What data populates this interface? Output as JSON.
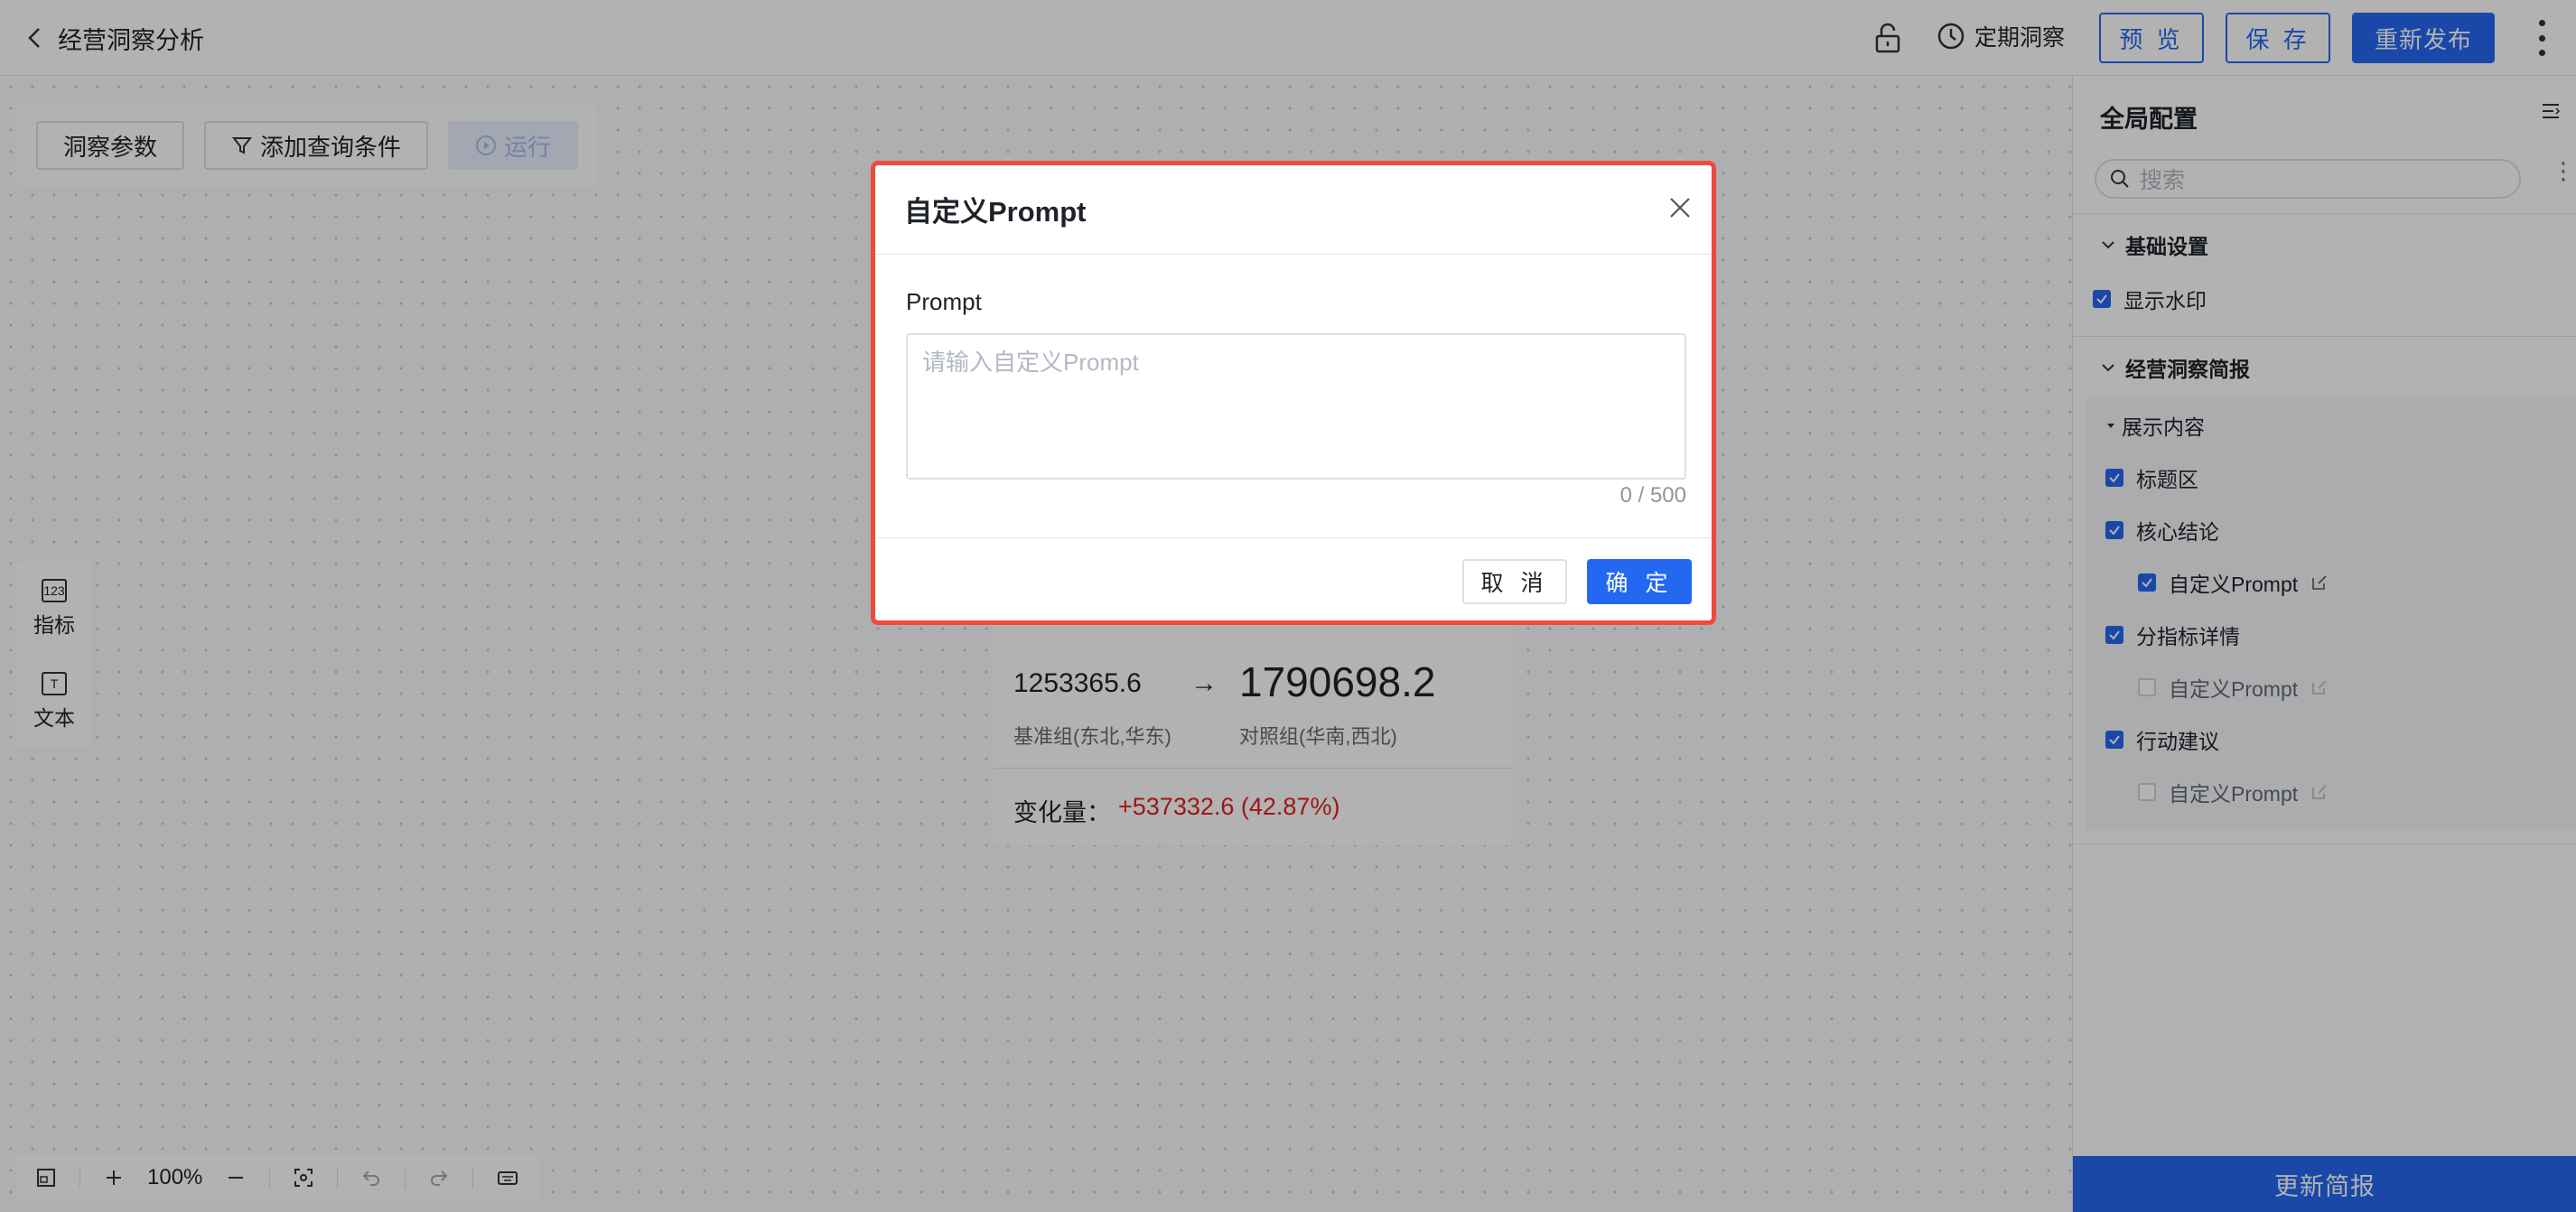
{
  "header": {
    "title": "经营洞察分析",
    "schedule_label": "定期洞察",
    "preview_label": "预 览",
    "save_label": "保 存",
    "republish_label": "重新发布"
  },
  "toolbar": {
    "params_label": "洞察参数",
    "add_filter_label": "添加查询条件",
    "run_label": "运行"
  },
  "side_tools": [
    {
      "label": "指标",
      "icon": "metric-icon"
    },
    {
      "label": "文本",
      "icon": "text-icon"
    }
  ],
  "metric_card": {
    "base_value": "1253365.6",
    "arrow": "→",
    "compare_value": "1790698.2",
    "base_label": "基准组(东北,华东)",
    "compare_label": "对照组(华南,西北)",
    "change_prefix": "变化量：",
    "change_value": "+537332.6 (42.87%)"
  },
  "bottom_bar": {
    "zoom": "100%"
  },
  "panel": {
    "title": "全局配置",
    "search_placeholder": "搜索",
    "section_basic": "基础设置",
    "show_watermark": "显示水印",
    "section_brief": "经营洞察简报",
    "display_content": "展示内容",
    "items": [
      {
        "label": "标题区",
        "checked": true
      },
      {
        "label": "核心结论",
        "checked": true
      },
      {
        "label": "自定义Prompt",
        "checked": true
      },
      {
        "label": "分指标详情",
        "checked": true
      },
      {
        "label": "自定义Prompt",
        "checked": false
      },
      {
        "label": "行动建议",
        "checked": true
      },
      {
        "label": "自定义Prompt",
        "checked": false
      }
    ],
    "update_label": "更新简报"
  },
  "modal": {
    "title": "自定义Prompt",
    "field_label": "Prompt",
    "placeholder": "请输入自定义Prompt",
    "value": "",
    "counter": "0 / 500",
    "cancel_label": "取 消",
    "ok_label": "确 定"
  },
  "colors": {
    "primary": "#2468f2",
    "danger": "#e02020",
    "highlight_border": "#ef4a3b"
  }
}
